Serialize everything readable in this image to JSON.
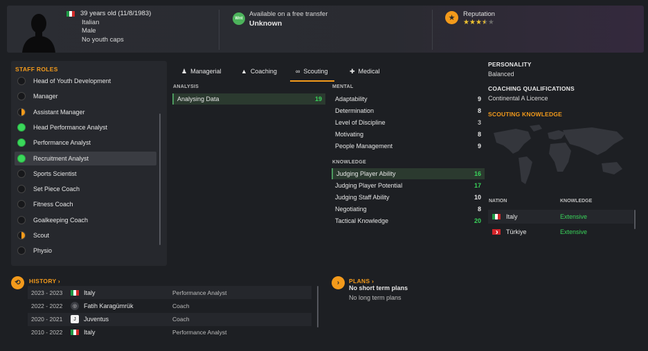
{
  "header": {
    "age_line": "39 years old (11/8/1983)",
    "nationality": "Italian",
    "gender": "Male",
    "youth_caps": "No youth caps",
    "transfer_label": "Available on a free transfer",
    "transfer_badge": "Wnt",
    "transfer_value": "Unknown",
    "reputation_label": "Reputation",
    "reputation_stars": 3.5,
    "reputation_max": 5
  },
  "staff_roles": {
    "title": "STAFF ROLES",
    "items": [
      {
        "label": "Head of Youth Development",
        "suitability": "none"
      },
      {
        "label": "Manager",
        "suitability": "none"
      },
      {
        "label": "Assistant Manager",
        "suitability": "half"
      },
      {
        "label": "Head Performance Analyst",
        "suitability": "full"
      },
      {
        "label": "Performance Analyst",
        "suitability": "full"
      },
      {
        "label": "Recruitment Analyst",
        "suitability": "full",
        "selected": true
      },
      {
        "label": "Sports Scientist",
        "suitability": "none"
      },
      {
        "label": "Set Piece Coach",
        "suitability": "none"
      },
      {
        "label": "Fitness Coach",
        "suitability": "none"
      },
      {
        "label": "Goalkeeping Coach",
        "suitability": "none"
      },
      {
        "label": "Scout",
        "suitability": "half"
      },
      {
        "label": "Physio",
        "suitability": "none"
      }
    ]
  },
  "tabs": [
    {
      "label": "Managerial",
      "icon": "person-icon"
    },
    {
      "label": "Coaching",
      "icon": "cones-icon"
    },
    {
      "label": "Scouting",
      "icon": "binoculars-icon",
      "active": true
    },
    {
      "label": "Medical",
      "icon": "medical-cross-icon"
    }
  ],
  "analysis": {
    "title": "ANALYSIS",
    "items": [
      {
        "label": "Analysing Data",
        "value": "19",
        "highlight": true
      }
    ]
  },
  "mental": {
    "title": "MENTAL",
    "items": [
      {
        "label": "Adaptability",
        "value": "9"
      },
      {
        "label": "Determination",
        "value": "8"
      },
      {
        "label": "Level of Discipline",
        "value": "3"
      },
      {
        "label": "Motivating",
        "value": "8"
      },
      {
        "label": "People Management",
        "value": "9"
      }
    ]
  },
  "knowledge": {
    "title": "KNOWLEDGE",
    "items": [
      {
        "label": "Judging Player Ability",
        "value": "16",
        "highlight": true
      },
      {
        "label": "Judging Player Potential",
        "value": "17"
      },
      {
        "label": "Judging Staff Ability",
        "value": "10"
      },
      {
        "label": "Negotiating",
        "value": "8"
      },
      {
        "label": "Tactical Knowledge",
        "value": "20"
      }
    ]
  },
  "personality": {
    "title": "PERSONALITY",
    "value": "Balanced"
  },
  "coaching_quals": {
    "title": "COACHING QUALIFICATIONS",
    "value": "Continental A Licence"
  },
  "scouting_knowledge": {
    "title": "SCOUTING KNOWLEDGE",
    "col_nation": "NATION",
    "col_knowledge": "KNOWLEDGE",
    "rows": [
      {
        "nation": "Italy",
        "knowledge": "Extensive"
      },
      {
        "nation": "Türkiye",
        "knowledge": "Extensive"
      }
    ]
  },
  "history": {
    "title": "HISTORY",
    "rows": [
      {
        "years": "2023 - 2023",
        "club": "Italy",
        "role": "Performance Analyst"
      },
      {
        "years": "2022 - 2022",
        "club": "Fatih Karagümrük",
        "role": "Coach"
      },
      {
        "years": "2020 - 2021",
        "club": "Juventus",
        "role": "Coach"
      },
      {
        "years": "2010 - 2022",
        "club": "Italy",
        "role": "Performance Analyst"
      }
    ]
  },
  "plans": {
    "title": "PLANS",
    "short_term": "No short term plans",
    "long_term": "No long term plans"
  },
  "colors": {
    "accent": "#f39a1b",
    "good": "#39d35a",
    "suit_full": "#3ad85a"
  }
}
